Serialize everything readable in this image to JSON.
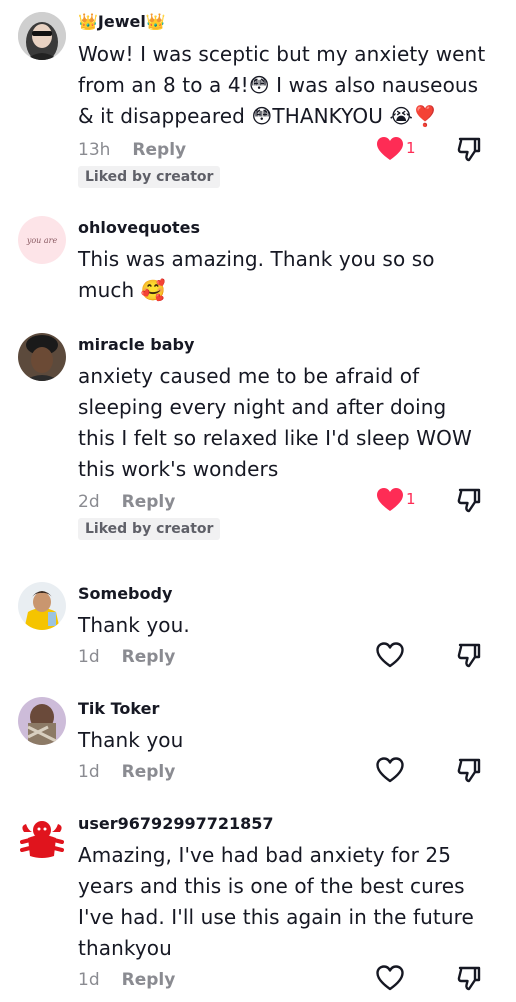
{
  "comments": [
    {
      "username": "👑Jewel👑",
      "text": "Wow! I was sceptic but my anxiety went from an 8 to a 4!😳 I was also nauseous & it disappeared 😳THANKYOU 😭❣️",
      "time": "13h",
      "reply_label": "Reply",
      "liked": true,
      "like_count": "1",
      "badge": "Liked by creator"
    },
    {
      "username": "ohlovequotes",
      "text": "This was amazing. Thank you so so much 🥰",
      "avatar_text": "you are"
    },
    {
      "username": "miracle baby",
      "text": "anxiety caused me to be afraid of sleeping every night and after doing this I felt so relaxed like I'd sleep WOW this work's wonders",
      "time": "2d",
      "reply_label": "Reply",
      "liked": true,
      "like_count": "1",
      "badge": "Liked by creator"
    },
    {
      "username": "Somebody",
      "text": "Thank you.",
      "time": "1d",
      "reply_label": "Reply",
      "liked": false
    },
    {
      "username": "Tik Toker",
      "text": "Thank you",
      "time": "1d",
      "reply_label": "Reply",
      "liked": false
    },
    {
      "username": "user96792997721857",
      "text": "Amazing, I've had bad anxiety for 25 years and this is one of the best cures I've had. I'll use this again in the future thankyou",
      "time": "1d",
      "reply_label": "Reply",
      "liked": false
    }
  ],
  "colors": {
    "like_active": "#fe2c55",
    "meta": "#8a8b91",
    "badge_bg": "#f1f1f2"
  },
  "icons": {
    "like": "heart-icon",
    "dislike": "thumbs-down-icon"
  }
}
